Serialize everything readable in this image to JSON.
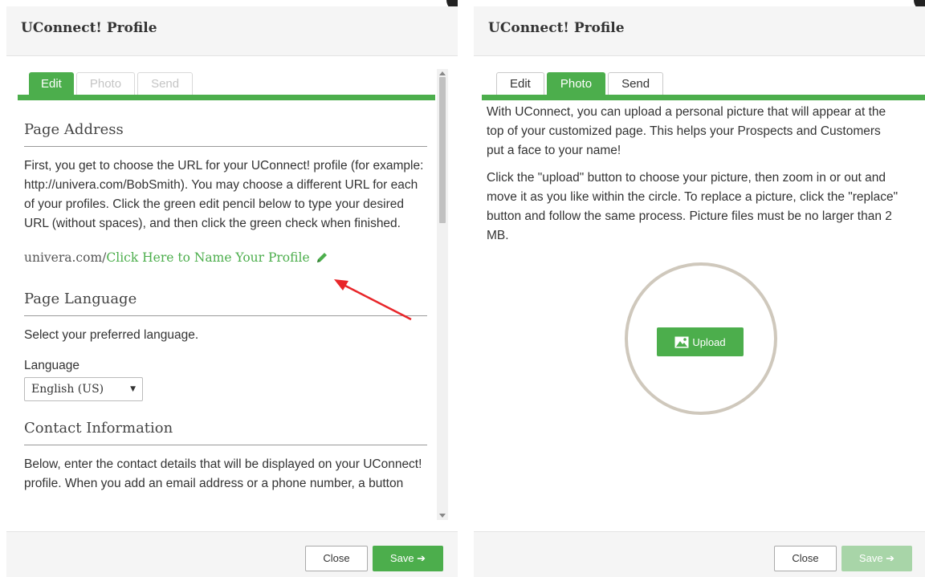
{
  "left": {
    "title": "UConnect! Profile",
    "tabs": [
      {
        "label": "Edit"
      },
      {
        "label": "Photo"
      },
      {
        "label": "Send"
      }
    ],
    "page_address": {
      "heading": "Page Address",
      "text": "First, you get to choose the URL for your UConnect! profile (for example: http://univera.com/BobSmith). You may choose a different URL for each of your profiles.  Click the green edit pencil below to type your desired URL (without spaces), and then click the green check when finished.",
      "url_prefix": "univera.com/",
      "url_link": "Click Here to Name Your Profile"
    },
    "page_language": {
      "heading": "Page Language",
      "text": "Select your preferred language.",
      "label": "Language",
      "selected": "English (US)"
    },
    "contact": {
      "heading": "Contact Information",
      "text": "Below, enter the contact details that will be displayed on your UConnect! profile. When you add an email address or a phone number, a button"
    },
    "close_label": "Close",
    "save_label": "Save ➔"
  },
  "right": {
    "title": "UConnect! Profile",
    "tabs": [
      {
        "label": "Edit"
      },
      {
        "label": "Photo"
      },
      {
        "label": "Send"
      }
    ],
    "para1": "With UConnect, you can upload a personal picture that will appear at the top of your customized page. This helps your Prospects and Customers put a face to your name!",
    "para2": "Click the \"upload\" button to choose your picture, then zoom in or out and move it as you like within the circle. To replace a picture, click the \"replace\" button and follow the same process. Picture files must be no larger than 2 MB.",
    "upload_label": "Upload",
    "close_label": "Close",
    "save_label": "Save ➔"
  },
  "colors": {
    "accent": "#4cae4c",
    "arrow": "#e8262a",
    "circle": "#cfc8bc"
  }
}
